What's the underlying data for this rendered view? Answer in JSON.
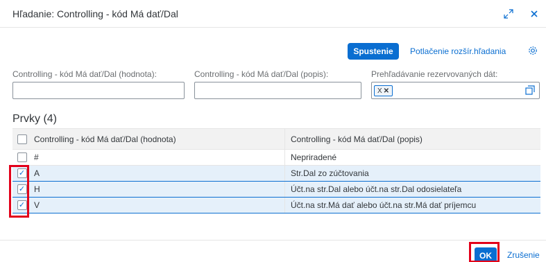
{
  "dialog": {
    "title": "Hľadanie: Controlling - kód Má dať/Dal"
  },
  "toolbar": {
    "go_label": "Spustenie",
    "hide_filter_label": "Potlačenie rozšír.hľadania"
  },
  "filters": {
    "value_label": "Controlling - kód Má dať/Dal (hodnota):",
    "value": "",
    "description_label": "Controlling - kód Má dať/Dal (popis):",
    "description": "",
    "reserved_label": "Prehľadávanie rezervovaných dát:",
    "reserved_token": "X"
  },
  "items": {
    "title": "Prvky (4)",
    "columns": [
      "Controlling - kód Má dať/Dal (hodnota)",
      "Controlling - kód Má dať/Dal (popis)"
    ],
    "rows": [
      {
        "value": "#",
        "description": "Nepriradené",
        "selected": false
      },
      {
        "value": "A",
        "description": "Str.Dal zo zúčtovania",
        "selected": true
      },
      {
        "value": "H",
        "description": "Účt.na str.Dal alebo účt.na str.Dal odosielateľa",
        "selected": true
      },
      {
        "value": "V",
        "description": "Účt.na str.Má dať alebo účt.na str.Má dať príjemcu",
        "selected": true
      }
    ]
  },
  "footer": {
    "ok_label": "OK",
    "cancel_label": "Zrušenie"
  },
  "colors": {
    "accent": "#0a6ed1",
    "highlight": "#e2001a",
    "selected_row": "#e5f0fa"
  }
}
